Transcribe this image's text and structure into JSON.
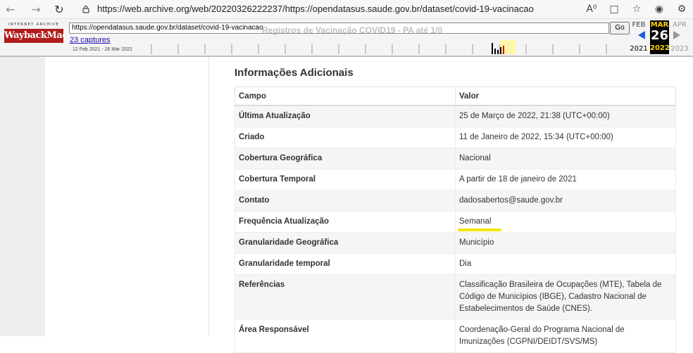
{
  "browser": {
    "url": "https://web.archive.org/web/20220326222237/https://opendatasus.saude.gov.br/dataset/covid-19-vacinacao",
    "icons": [
      "back-icon",
      "forward-icon",
      "reload-icon",
      "lock-icon",
      "read-aloud-icon",
      "reader-view-icon",
      "favorite-icon",
      "profile-icon",
      "extensions-icon"
    ]
  },
  "wayback": {
    "logo_top": "INTERNET ARCHIVE",
    "logo_main": "WaybackMachine",
    "url_value": "https://opendatasus.saude.gov.br/dataset/covid-19-vacinacao",
    "go_label": "Go",
    "captures_label": "23 captures",
    "capture_range": "12 Feb 2021 - 26 Mar 2022",
    "ghost_text": "Registros de Vacinação COVID19 - PA até 1/0",
    "prev_month": "FEB",
    "cur_month": "MAR",
    "cur_day": "26",
    "next_month": "APR",
    "prev_year": "2021",
    "cur_year": "2022",
    "next_year": "2023",
    "accent_color": "#ffd400"
  },
  "section": {
    "title": "Informações Adicionais",
    "headers": [
      "Campo",
      "Valor"
    ],
    "rows": [
      {
        "k": "Última Atualização",
        "v": "25 de Março de 2022, 21:38 (UTC+00:00)"
      },
      {
        "k": "Criado",
        "v": "11 de Janeiro de 2022, 15:34 (UTC+00:00)"
      },
      {
        "k": "Cobertura Geográfica",
        "v": "Nacional"
      },
      {
        "k": "Cobertura Temporal",
        "v": "A partir de 18 de janeiro de 2021"
      },
      {
        "k": "Contato",
        "v": "dadosabertos@saude.gov.br"
      },
      {
        "k": "Frequência Atualização",
        "v": "Semanal"
      },
      {
        "k": "Granularidade Geográfica",
        "v": "Município"
      },
      {
        "k": "Granularidade temporal",
        "v": "Dia"
      },
      {
        "k": "Referências",
        "v": "Classificação Brasileira de Ocupações (MTE), Tabela de Código de Municípios (IBGE), Cadastro Nacional de Estabelecimentos de Saúde (CNES)."
      },
      {
        "k": "Área Responsável",
        "v": "Coordenação-Geral do Programa Nacional de Imunizações (CGPNI/DEIDT/SVS/MS)"
      }
    ],
    "highlight_color": "#f5e400"
  }
}
